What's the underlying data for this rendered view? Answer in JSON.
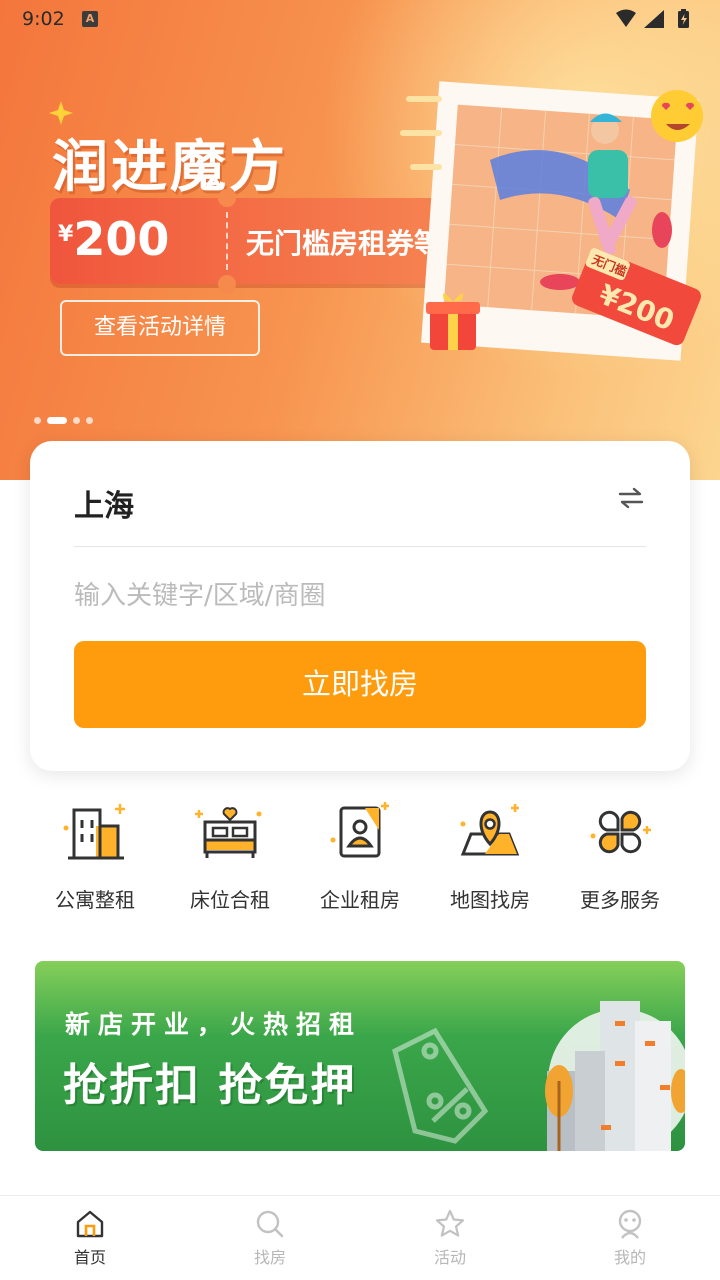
{
  "status_bar": {
    "time": "9:02",
    "badge": "A"
  },
  "banner": {
    "title": "润进魔方",
    "coupon": {
      "currency": "¥",
      "amount": "200",
      "text": "无门槛房租券等你拿~"
    },
    "detail_button": "查看活动详情",
    "ticket_tag_top": "无门槛",
    "ticket_tag_amount": "¥200",
    "carousel": {
      "count": 4,
      "active_index": 1
    }
  },
  "search": {
    "city": "上海",
    "keyword_placeholder": "输入关键字/区域/商圈",
    "keyword_value": "",
    "submit_label": "立即找房"
  },
  "services": [
    {
      "label": "公寓整租",
      "icon": "building-icon"
    },
    {
      "label": "床位合租",
      "icon": "bed-icon"
    },
    {
      "label": "企业租房",
      "icon": "id-card-icon"
    },
    {
      "label": "地图找房",
      "icon": "map-pin-icon"
    },
    {
      "label": "更多服务",
      "icon": "grid-icon"
    }
  ],
  "promo": {
    "subtitle": "新店开业，火热招租",
    "headline": "抢折扣 抢免押"
  },
  "tabbar": {
    "items": [
      {
        "label": "首页",
        "icon": "home-icon",
        "active": true
      },
      {
        "label": "找房",
        "icon": "search-icon",
        "active": false
      },
      {
        "label": "活动",
        "icon": "star-icon",
        "active": false
      },
      {
        "label": "我的",
        "icon": "user-icon",
        "active": false
      }
    ]
  },
  "colors": {
    "accent": "#ff9c0d",
    "banner_orange": "#f4763c",
    "promo_green": "#3aa64a"
  }
}
